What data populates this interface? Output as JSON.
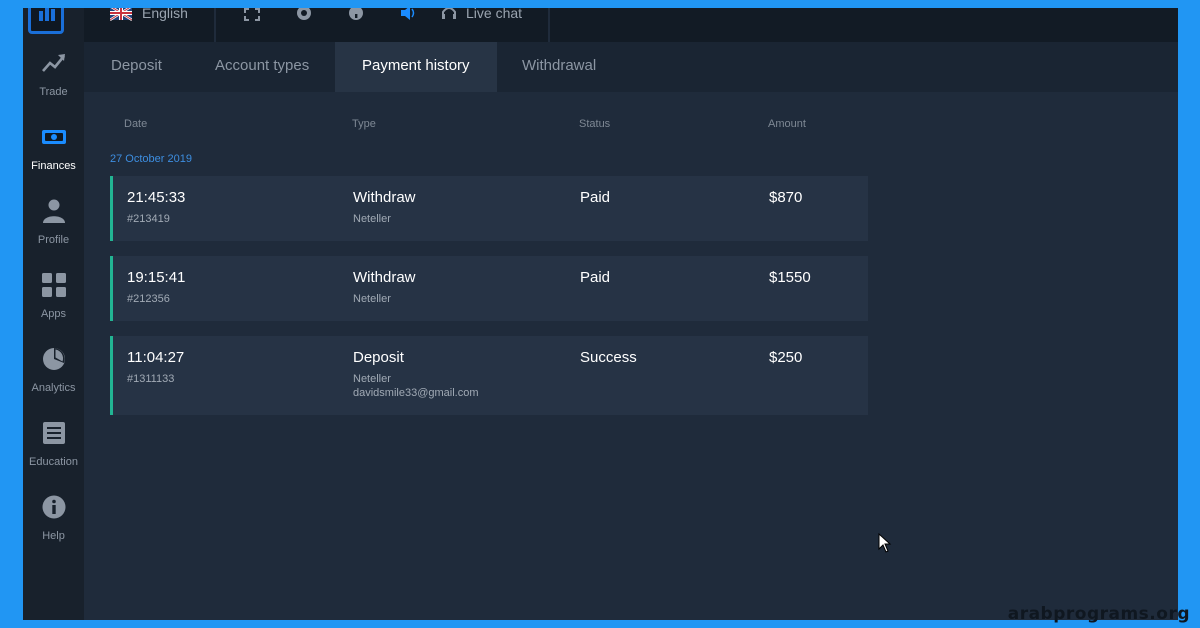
{
  "topbar": {
    "language": "English",
    "live_chat": "Live chat",
    "icons": [
      "uk-flag-icon",
      "fullscreen-icon",
      "settings-gear-icon",
      "help-icon",
      "sound-icon",
      "headset-icon"
    ]
  },
  "sidebar": {
    "items": [
      {
        "label": "Trade",
        "icon": "trend-up-icon"
      },
      {
        "label": "Finances",
        "icon": "money-icon"
      },
      {
        "label": "Profile",
        "icon": "user-icon"
      },
      {
        "label": "Apps",
        "icon": "grid-icon"
      },
      {
        "label": "Analytics",
        "icon": "pie-chart-icon"
      },
      {
        "label": "Education",
        "icon": "book-icon"
      },
      {
        "label": "Help",
        "icon": "info-icon"
      }
    ],
    "active": "Finances"
  },
  "tabs": [
    {
      "label": "Deposit"
    },
    {
      "label": "Account types"
    },
    {
      "label": "Payment history"
    },
    {
      "label": "Withdrawal"
    }
  ],
  "table": {
    "headers": {
      "date": "Date",
      "type": "Type",
      "status": "Status",
      "amount": "Amount"
    },
    "date_group": "27 October 2019",
    "rows": [
      {
        "time": "21:45:33",
        "id": "#213419",
        "type": "Withdraw",
        "method": "Neteller",
        "email": "",
        "status": "Paid",
        "amount": "$870"
      },
      {
        "time": "19:15:41",
        "id": "#212356",
        "type": "Withdraw",
        "method": "Neteller",
        "email": "",
        "status": "Paid",
        "amount": "$1550"
      },
      {
        "time": "11:04:27",
        "id": "#1311133",
        "type": "Deposit",
        "method": "Neteller",
        "email": "davidsmile33@gmail.com",
        "status": "Success",
        "amount": "$250"
      }
    ]
  },
  "watermark": "arabprograms.org",
  "colors": {
    "accent": "#3d8ee0",
    "row_marker": "#22b593",
    "border": "#2196f3"
  }
}
